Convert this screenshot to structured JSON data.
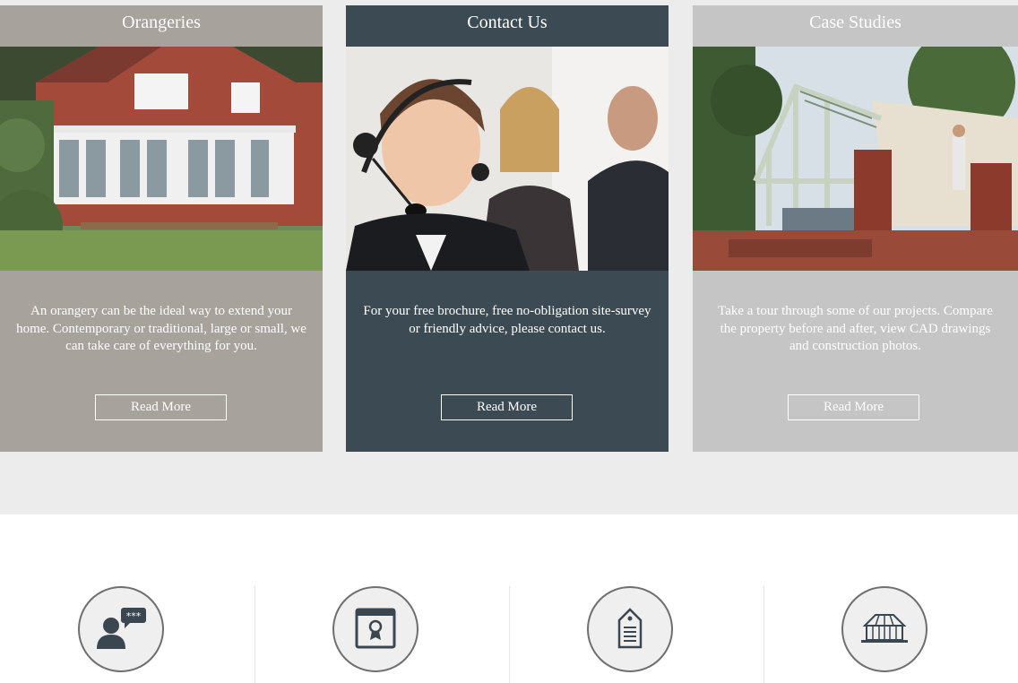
{
  "cards": [
    {
      "title": "Orangeries",
      "description": "An orangery can be the ideal way to extend your home. Contemporary or traditional, large or small, we can take care of everything for you.",
      "button": "Read More",
      "color": "#a7a29b"
    },
    {
      "title": "Contact Us",
      "description": "For your free brochure, free no-obligation site-survey or friendly advice, please contact us.",
      "button": "Read More",
      "color": "#3c4a53"
    },
    {
      "title": "Case Studies",
      "description": "Take a tour through some of our projects. Compare the property before and after, view CAD drawings and construction photos.",
      "button": "Read More",
      "color": "#c5c5c5"
    }
  ],
  "features": [
    {
      "icon": "customer-reviews-icon"
    },
    {
      "icon": "certificate-award-icon"
    },
    {
      "icon": "price-tag-icon"
    },
    {
      "icon": "conservatory-icon"
    }
  ]
}
